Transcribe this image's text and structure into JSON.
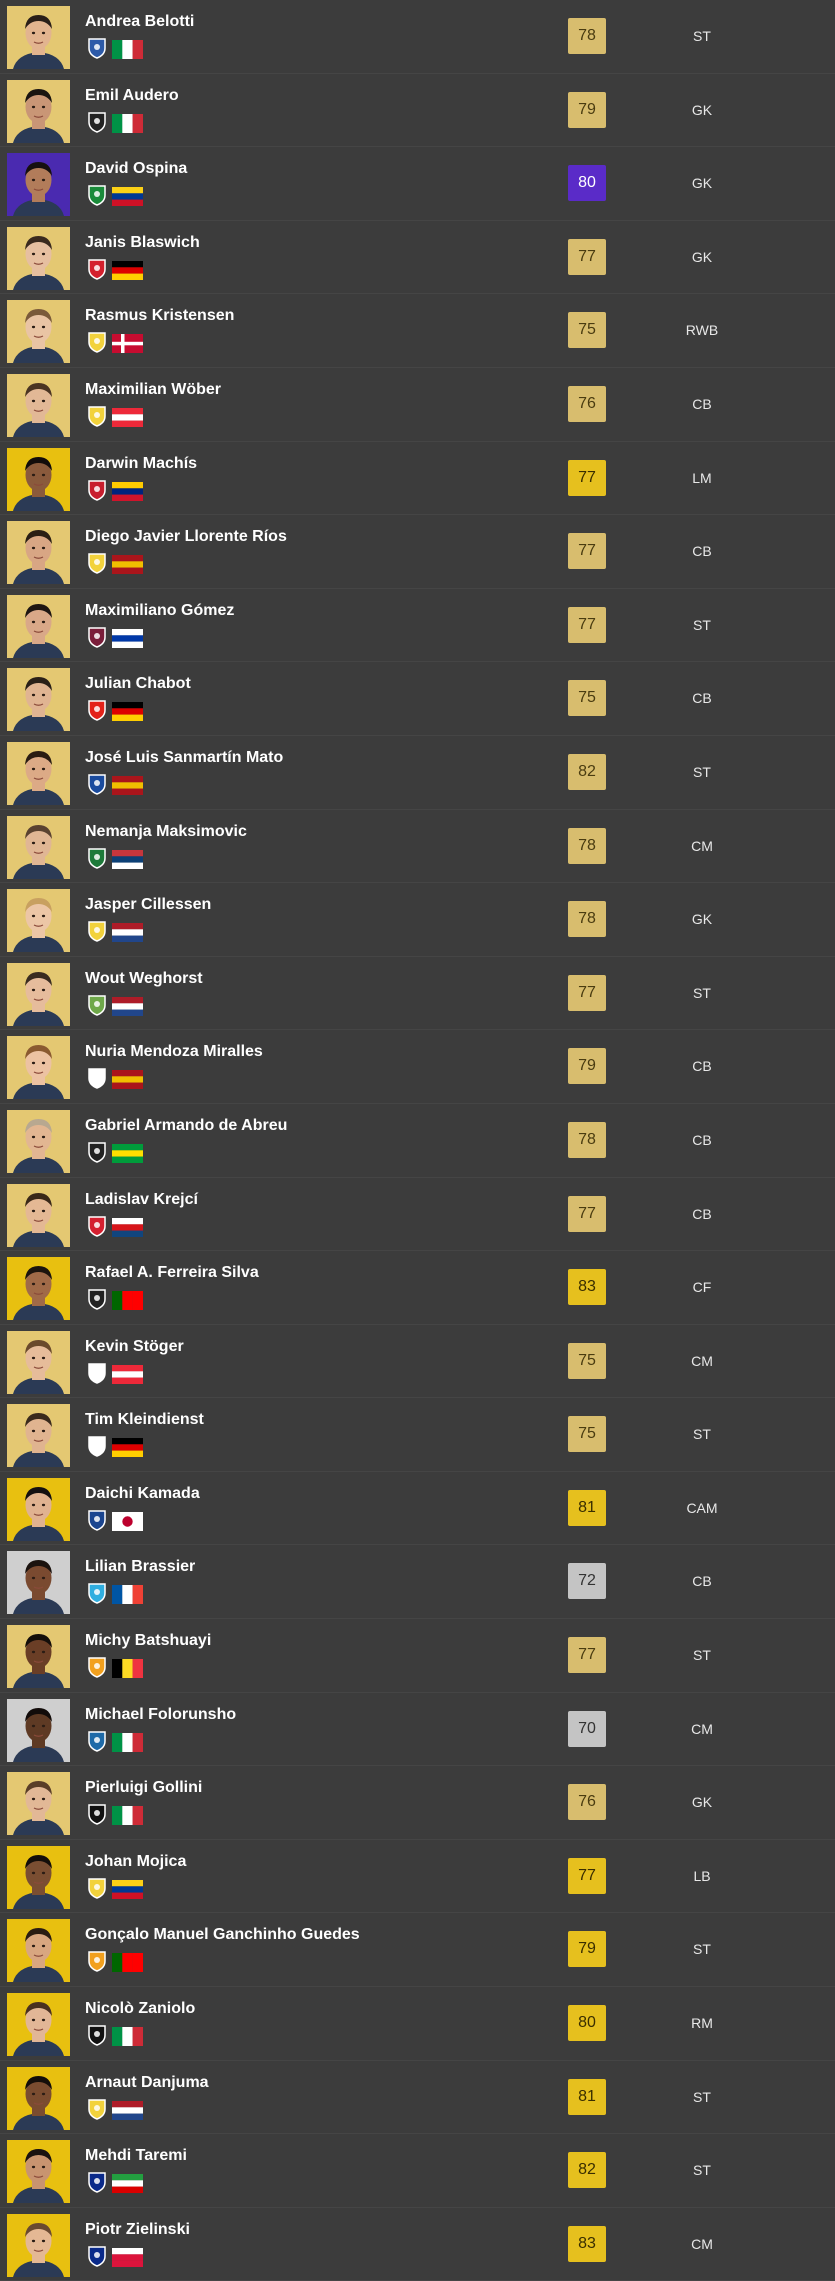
{
  "players": [
    {
      "name": "Andrea Belotti",
      "rating": "78",
      "position": "ST",
      "tier": "gold",
      "skin": "#e2b48f",
      "hair": "#2a1f18",
      "club": "#2d5aa8",
      "flag": [
        "#009246",
        "#ffffff",
        "#ce2b37"
      ],
      "flag_dir": "v"
    },
    {
      "name": "Emil Audero",
      "rating": "79",
      "position": "GK",
      "tier": "gold",
      "skin": "#c99676",
      "hair": "#1a1410",
      "club": "#222222",
      "flag": [
        "#009246",
        "#ffffff",
        "#ce2b37"
      ],
      "flag_dir": "v"
    },
    {
      "name": "David Ospina",
      "rating": "80",
      "position": "GK",
      "tier": "purple",
      "skin": "#b27c5a",
      "hair": "#161010",
      "club": "#1a8b3a",
      "flag": [
        "#fcd116",
        "#003893",
        "#ce1126"
      ],
      "flag_dir": "h"
    },
    {
      "name": "Janis Blaswich",
      "rating": "77",
      "position": "GK",
      "tier": "gold",
      "skin": "#e6bfa0",
      "hair": "#3a2a1e",
      "club": "#d4202d",
      "flag": [
        "#000000",
        "#dd0000",
        "#ffce00"
      ],
      "flag_dir": "h"
    },
    {
      "name": "Rasmus Kristensen",
      "rating": "75",
      "position": "RWB",
      "tier": "gold",
      "skin": "#e9c4a4",
      "hair": "#7a5a3a",
      "club": "#f2d23c",
      "flag": [
        "#c60c30",
        "#ffffff",
        "#c60c30"
      ],
      "flag_dir": "cross"
    },
    {
      "name": "Maximilian Wöber",
      "rating": "76",
      "position": "CB",
      "tier": "gold",
      "skin": "#e2b896",
      "hair": "#4a3422",
      "club": "#f2d23c",
      "flag": [
        "#ed2939",
        "#ffffff",
        "#ed2939"
      ],
      "flag_dir": "h"
    },
    {
      "name": "Darwin Machís",
      "rating": "77",
      "position": "LM",
      "tier": "gold-bright",
      "skin": "#8a5a3c",
      "hair": "#120c0a",
      "club": "#c81e2e",
      "flag": [
        "#ffcc00",
        "#00247d",
        "#cf142b"
      ],
      "flag_dir": "h"
    },
    {
      "name": "Diego Javier Llorente Ríos",
      "rating": "77",
      "position": "CB",
      "tier": "gold",
      "skin": "#d8a684",
      "hair": "#2a1e14",
      "club": "#f2d23c",
      "flag": [
        "#aa151b",
        "#f1bf00",
        "#aa151b"
      ],
      "flag_dir": "h"
    },
    {
      "name": "Maximiliano Gómez",
      "rating": "77",
      "position": "ST",
      "tier": "gold",
      "skin": "#d9a888",
      "hair": "#1e1612",
      "club": "#7a1e3a",
      "flag": [
        "#ffffff",
        "#0038a8",
        "#ffffff"
      ],
      "flag_dir": "h"
    },
    {
      "name": "Julian Chabot",
      "rating": "75",
      "position": "CB",
      "tier": "gold",
      "skin": "#e0b492",
      "hair": "#2a2018",
      "club": "#e32219",
      "flag": [
        "#000000",
        "#dd0000",
        "#ffce00"
      ],
      "flag_dir": "h"
    },
    {
      "name": "José Luis Sanmartín Mato",
      "rating": "82",
      "position": "ST",
      "tier": "gold",
      "skin": "#dcaa86",
      "hair": "#2a1c12",
      "club": "#1a4b9e",
      "flag": [
        "#aa151b",
        "#f1bf00",
        "#aa151b"
      ],
      "flag_dir": "h"
    },
    {
      "name": "Nemanja Maksimovic",
      "rating": "78",
      "position": "CM",
      "tier": "gold",
      "skin": "#e0b694",
      "hair": "#5a4230",
      "club": "#1e7a3a",
      "flag": [
        "#c6363c",
        "#0c4076",
        "#ffffff"
      ],
      "flag_dir": "h"
    },
    {
      "name": "Jasper Cillessen",
      "rating": "78",
      "position": "GK",
      "tier": "gold",
      "skin": "#ecc6a6",
      "hair": "#c8a060",
      "club": "#f2d23c",
      "flag": [
        "#ae1c28",
        "#ffffff",
        "#21468b"
      ],
      "flag_dir": "h"
    },
    {
      "name": "Wout Weghorst",
      "rating": "77",
      "position": "ST",
      "tier": "gold",
      "skin": "#e6bc9c",
      "hair": "#3a2c20",
      "club": "#6fa84a",
      "flag": [
        "#ae1c28",
        "#ffffff",
        "#21468b"
      ],
      "flag_dir": "h"
    },
    {
      "name": "Nuria Mendoza Miralles",
      "rating": "79",
      "position": "CB",
      "tier": "gold",
      "skin": "#ecc2a2",
      "hair": "#8a5a30",
      "club": "#ffffff",
      "flag": [
        "#aa151b",
        "#f1bf00",
        "#aa151b"
      ],
      "flag_dir": "h"
    },
    {
      "name": "Gabriel Armando de Abreu",
      "rating": "78",
      "position": "CB",
      "tier": "gold",
      "skin": "#e2b692",
      "hair": "#b8a890",
      "club": "#222222",
      "flag": [
        "#009c3b",
        "#ffdf00",
        "#009c3b"
      ],
      "flag_dir": "h"
    },
    {
      "name": "Ladislav Krejcí",
      "rating": "77",
      "position": "CB",
      "tier": "gold",
      "skin": "#e4b894",
      "hair": "#3a2818",
      "club": "#d42030",
      "flag": [
        "#ffffff",
        "#d7141a",
        "#11457e"
      ],
      "flag_dir": "h"
    },
    {
      "name": "Rafael A. Ferreira Silva",
      "rating": "83",
      "position": "CF",
      "tier": "gold-bright",
      "skin": "#a06a48",
      "hair": "#1c140e",
      "club": "#222222",
      "flag": [
        "#006600",
        "#ff0000",
        "#ff0000"
      ],
      "flag_dir": "v"
    },
    {
      "name": "Kevin Stöger",
      "rating": "75",
      "position": "CM",
      "tier": "gold",
      "skin": "#e6bc9a",
      "hair": "#6a4a2c",
      "club": "#ffffff",
      "flag": [
        "#ed2939",
        "#ffffff",
        "#ed2939"
      ],
      "flag_dir": "h"
    },
    {
      "name": "Tim Kleindienst",
      "rating": "75",
      "position": "ST",
      "tier": "gold",
      "skin": "#e0b490",
      "hair": "#3a2a1c",
      "club": "#ffffff",
      "flag": [
        "#000000",
        "#dd0000",
        "#ffce00"
      ],
      "flag_dir": "h"
    },
    {
      "name": "Daichi Kamada",
      "rating": "81",
      "position": "CAM",
      "tier": "gold-bright",
      "skin": "#e0b290",
      "hair": "#141010",
      "club": "#1b458f",
      "flag": [
        "#ffffff",
        "#bc002d",
        "#ffffff"
      ],
      "flag_dir": "dot"
    },
    {
      "name": "Lilian Brassier",
      "rating": "72",
      "position": "CB",
      "tier": "silver",
      "skin": "#7a4a30",
      "hair": "#1a120e",
      "club": "#2faee0",
      "flag": [
        "#0055a4",
        "#ffffff",
        "#ef4135"
      ],
      "flag_dir": "v"
    },
    {
      "name": "Michy Batshuayi",
      "rating": "77",
      "position": "ST",
      "tier": "gold",
      "skin": "#6a3e26",
      "hair": "#140e0a",
      "club": "#f2a01e",
      "flag": [
        "#000000",
        "#fdda24",
        "#ef3340"
      ],
      "flag_dir": "v"
    },
    {
      "name": "Michael Folorunsho",
      "rating": "70",
      "position": "CM",
      "tier": "silver",
      "skin": "#5e3a24",
      "hair": "#120c0a",
      "club": "#1e6aa8",
      "flag": [
        "#009246",
        "#ffffff",
        "#ce2b37"
      ],
      "flag_dir": "v"
    },
    {
      "name": "Pierluigi Gollini",
      "rating": "76",
      "position": "GK",
      "tier": "gold",
      "skin": "#e2b896",
      "hair": "#5a3e28",
      "club": "#111111",
      "flag": [
        "#009246",
        "#ffffff",
        "#ce2b37"
      ],
      "flag_dir": "v"
    },
    {
      "name": "Johan Mojica",
      "rating": "77",
      "position": "LB",
      "tier": "gold-bright",
      "skin": "#7a4e32",
      "hair": "#140e0a",
      "club": "#f2d23c",
      "flag": [
        "#fcd116",
        "#003893",
        "#ce1126"
      ],
      "flag_dir": "h"
    },
    {
      "name": "Gonçalo Manuel Ganchinho Guedes",
      "rating": "79",
      "position": "ST",
      "tier": "gold-bright",
      "skin": "#d8a680",
      "hair": "#2a1c12",
      "club": "#f2a01e",
      "flag": [
        "#006600",
        "#ff0000",
        "#ff0000"
      ],
      "flag_dir": "v"
    },
    {
      "name": "Nicolò Zaniolo",
      "rating": "80",
      "position": "RM",
      "tier": "gold-bright",
      "skin": "#e2b696",
      "hair": "#4a3020",
      "club": "#111111",
      "flag": [
        "#009246",
        "#ffffff",
        "#ce2b37"
      ],
      "flag_dir": "v"
    },
    {
      "name": "Arnaut Danjuma",
      "rating": "81",
      "position": "ST",
      "tier": "gold-bright",
      "skin": "#7a4c30",
      "hair": "#140e0a",
      "club": "#f2d23c",
      "flag": [
        "#ae1c28",
        "#ffffff",
        "#21468b"
      ],
      "flag_dir": "h"
    },
    {
      "name": "Mehdi Taremi",
      "rating": "82",
      "position": "ST",
      "tier": "gold-bright",
      "skin": "#c89470",
      "hair": "#1a1210",
      "club": "#0a2a8a",
      "flag": [
        "#239f40",
        "#ffffff",
        "#da0000"
      ],
      "flag_dir": "h"
    },
    {
      "name": "Piotr Zielinski",
      "rating": "83",
      "position": "CM",
      "tier": "gold-bright",
      "skin": "#e4b894",
      "hair": "#6a4a30",
      "club": "#0a2a8a",
      "flag": [
        "#ffffff",
        "#dc143c",
        "#dc143c"
      ],
      "flag_dir": "h"
    }
  ],
  "colors": {
    "page_background": "#3c3c3c",
    "tier_gold": "#d8bd6e",
    "tier_gold_bright": "#e6c01e",
    "tier_purple": "#5a2bc8",
    "tier_silver": "#c4c4c4",
    "avatar_gold": "#e4c872",
    "avatar_bright": "#e8c010",
    "avatar_purple": "#4a2ab0",
    "avatar_silver": "#cfcfcf"
  }
}
